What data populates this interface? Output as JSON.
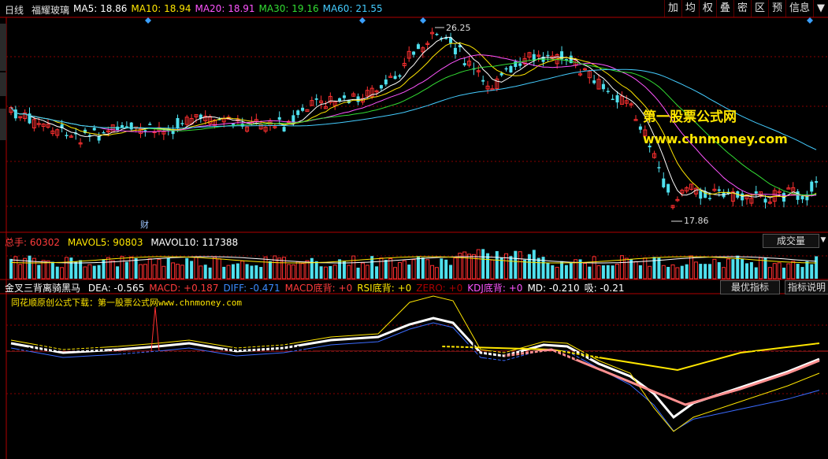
{
  "header": {
    "period": "日线",
    "stock_name": "福耀玻璃",
    "ma": [
      {
        "label": "MA5: ",
        "value": "18.86",
        "color": "#ffffff"
      },
      {
        "label": "MA10: ",
        "value": "18.94",
        "color": "#ffe600"
      },
      {
        "label": "MA20: ",
        "value": "18.91",
        "color": "#ff55ff"
      },
      {
        "label": "MA30: ",
        "value": "19.16",
        "color": "#33dd33"
      },
      {
        "label": "MA60: ",
        "value": "21.55",
        "color": "#44ccff"
      }
    ],
    "toolbar": [
      "加",
      "均",
      "权",
      "叠",
      "密",
      "区",
      "预",
      "信息",
      "▼"
    ]
  },
  "price": {
    "high_label": "26.25",
    "low_label": "17.86",
    "cai_label": "财"
  },
  "volume": {
    "total_label": "总手: ",
    "total_value": "60302",
    "mavol5_label": "MAVOL5: ",
    "mavol5_value": "90803",
    "mavol10_label": "MAVOL10: ",
    "mavol10_value": "117388",
    "button": "成交量",
    "dropdown": "▼"
  },
  "indicator": {
    "name": "金叉三背离骑黑马",
    "items": [
      {
        "label": "DEA: ",
        "value": "-0.565",
        "color": "#ffffff"
      },
      {
        "label": "MACD: ",
        "value": "+0.187",
        "color": "#ff3b3b"
      },
      {
        "label": "DIFF: ",
        "value": "-0.471",
        "color": "#3b8bff"
      },
      {
        "label": "MACD底背: ",
        "value": "+0",
        "color": "#ff3b3b"
      },
      {
        "label": "RSI底背: ",
        "value": "+0",
        "color": "#ffe600"
      },
      {
        "label": "ZERO: ",
        "value": "+0",
        "color": "#aa0000"
      },
      {
        "label": "KDJ底背: ",
        "value": "+0",
        "color": "#ff55ff"
      },
      {
        "label": "MD: ",
        "value": "-0.210",
        "color": "#ffffff"
      },
      {
        "label": "吸: ",
        "value": "-0.21",
        "color": "#ffffff"
      }
    ],
    "btn_best": "最优指标",
    "btn_help": "指标说明",
    "caption_cn": "同花顺原创公式下载：第一股票公式网",
    "caption_url": "www.chnmoney.com"
  },
  "watermark": {
    "title": "第一股票公式网",
    "url": "www.chnmoney.com"
  },
  "colors": {
    "up": "#ff3030",
    "down": "#4fe0ee",
    "grid": "#8a0000",
    "frame": "#b00000"
  }
}
